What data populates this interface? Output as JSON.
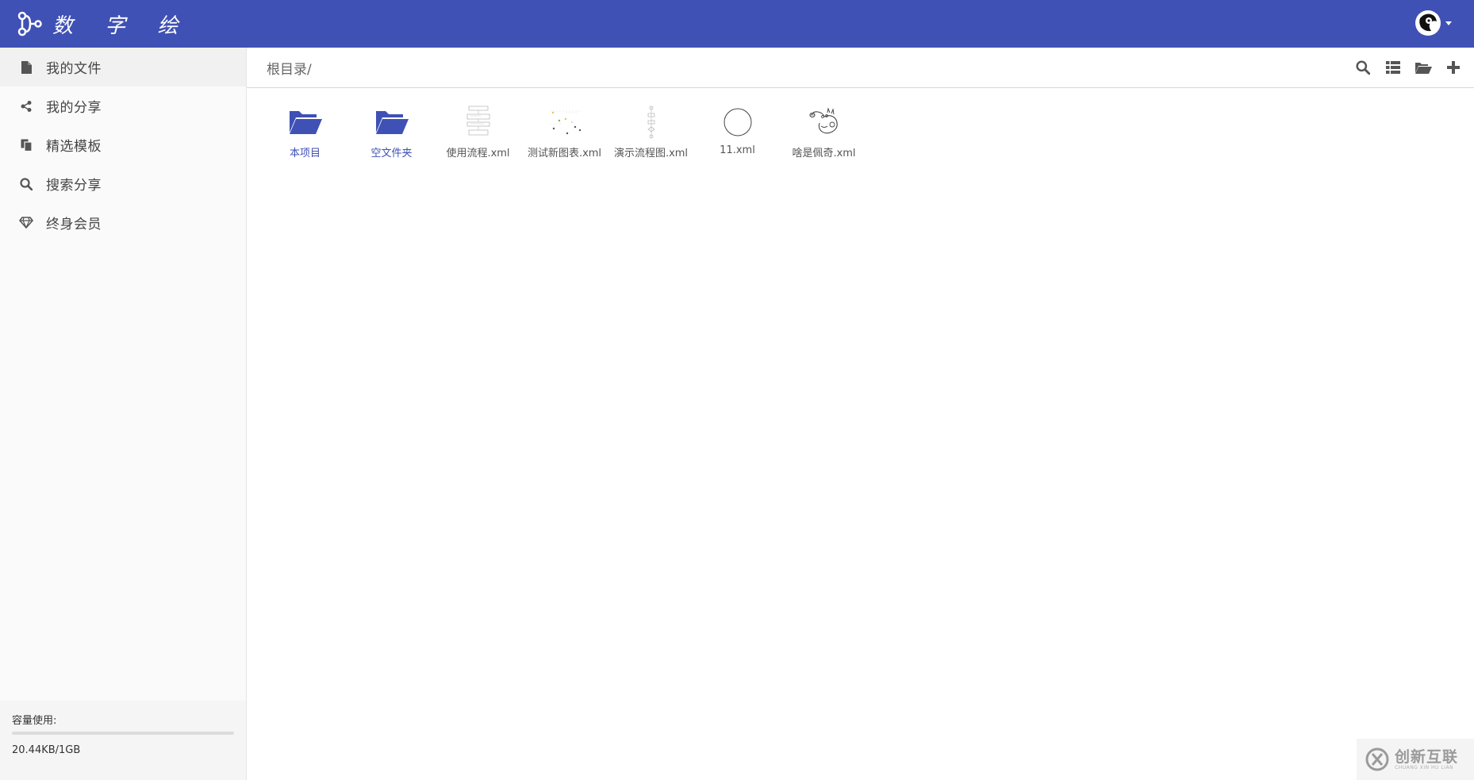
{
  "app": {
    "title": "数 字 绘",
    "logo_icon": "flow-node-icon",
    "brand_color": "#3f51b5"
  },
  "user": {
    "avatar_icon": "user-avatar-icon"
  },
  "sidebar": {
    "items": [
      {
        "label": "我的文件",
        "icon": "file-icon",
        "active": true
      },
      {
        "label": "我的分享",
        "icon": "share-icon",
        "active": false
      },
      {
        "label": "精选模板",
        "icon": "copy-icon",
        "active": false
      },
      {
        "label": "搜索分享",
        "icon": "search-icon",
        "active": false
      },
      {
        "label": "终身会员",
        "icon": "diamond-icon",
        "active": false
      }
    ],
    "storage": {
      "label": "容量使用:",
      "value": "20.44KB/1GB",
      "used_fraction": 2e-05
    }
  },
  "toolbar": {
    "breadcrumb": "根目录/",
    "actions": [
      "search-icon",
      "list-view-icon",
      "open-folder-icon",
      "plus-icon"
    ]
  },
  "files": [
    {
      "name": "本项目",
      "type": "folder"
    },
    {
      "name": "空文件夹",
      "type": "folder"
    },
    {
      "name": "使用流程.xml",
      "type": "diagram"
    },
    {
      "name": "测试新图表.xml",
      "type": "diagram"
    },
    {
      "name": "演示流程图.xml",
      "type": "diagram"
    },
    {
      "name": "11.xml",
      "type": "diagram"
    },
    {
      "name": "啥是佩奇.xml",
      "type": "diagram"
    }
  ],
  "watermark": {
    "cn": "创新互联",
    "en": "CHUANG XIN HU LIAN"
  }
}
